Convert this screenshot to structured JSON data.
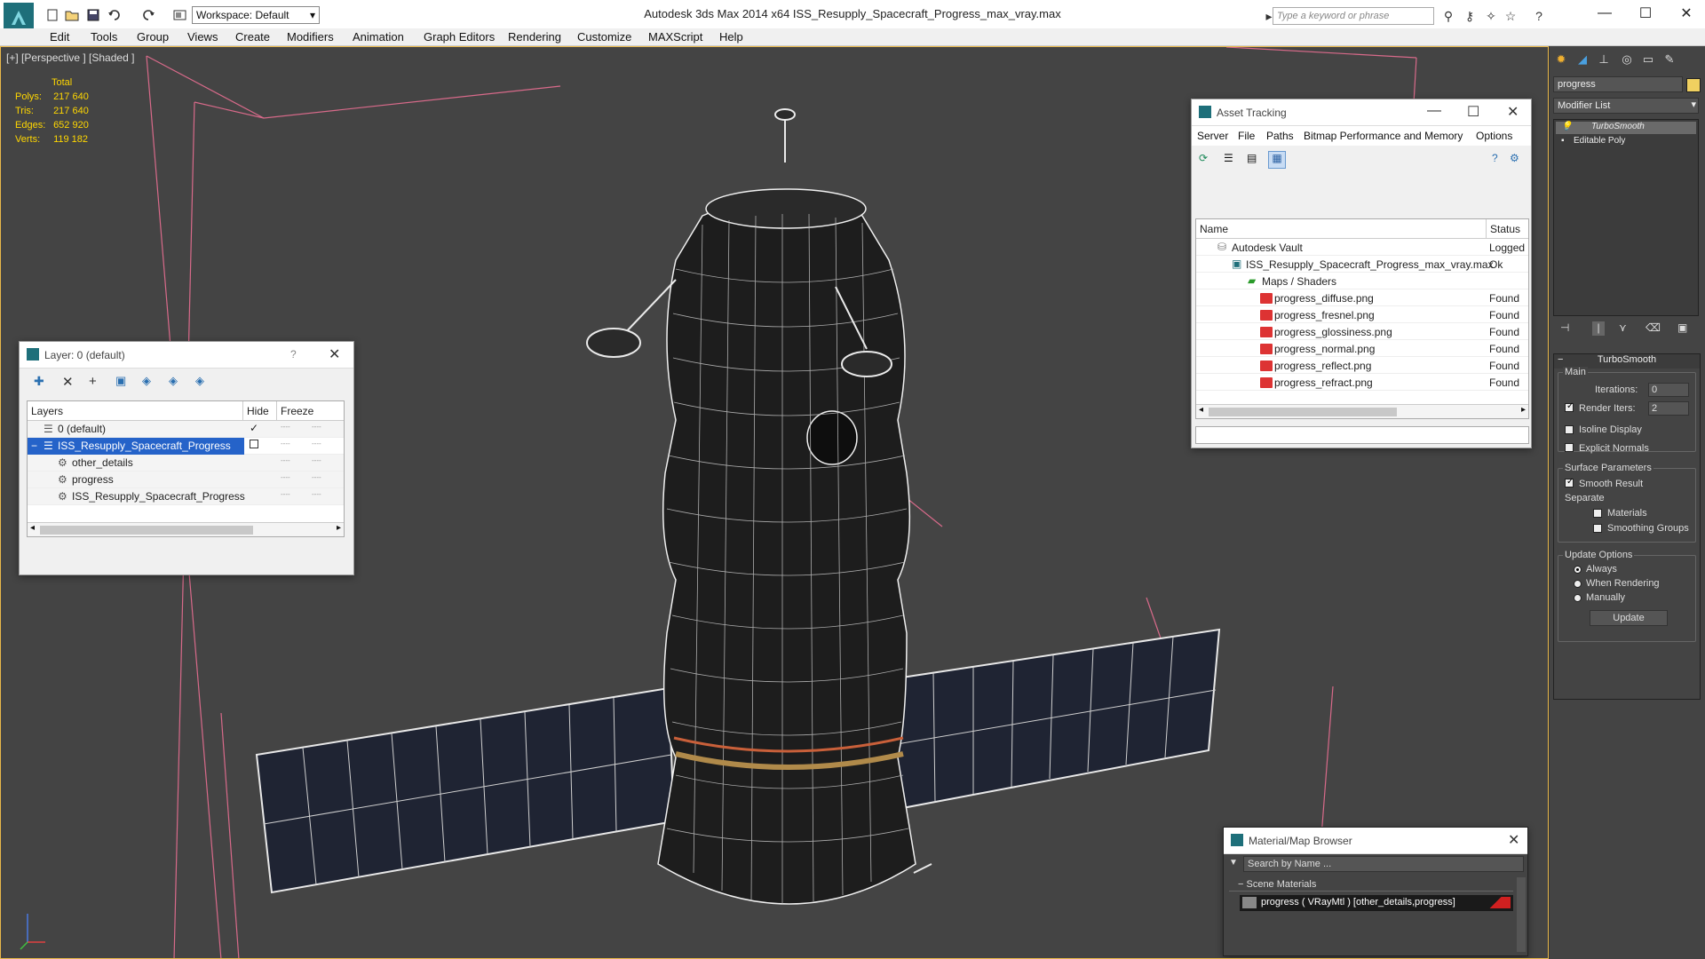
{
  "app": {
    "title": "Autodesk 3ds Max  2014 x64     ISS_Resupply_Spacecraft_Progress_max_vray.max",
    "workspace_label": "Workspace: Default",
    "search_placeholder": "Type a keyword or phrase"
  },
  "menu": [
    "Edit",
    "Tools",
    "Group",
    "Views",
    "Create",
    "Modifiers",
    "Animation",
    "Graph Editors",
    "Rendering",
    "Customize",
    "MAXScript",
    "Help"
  ],
  "viewport": {
    "label": "[+] [Perspective ] [Shaded ]",
    "stats": {
      "total_label": "Total",
      "rows": [
        {
          "k": "Polys:",
          "v": "217 640"
        },
        {
          "k": "Tris:",
          "v": "217 640"
        },
        {
          "k": "Edges:",
          "v": "652 920"
        },
        {
          "k": "Verts:",
          "v": "119 182"
        }
      ]
    }
  },
  "layer_dialog": {
    "title": "Layer: 0 (default)",
    "help": "?",
    "columns": {
      "layers": "Layers",
      "hide": "Hide",
      "freeze": "Freeze"
    },
    "rows": [
      {
        "name": "0 (default)",
        "dash1": "----",
        "dash2": "----"
      },
      {
        "name": "ISS_Resupply_Spacecraft_Progress",
        "dash1": "----",
        "dash2": "----"
      },
      {
        "name": "other_details",
        "dash1": "----",
        "dash2": "----"
      },
      {
        "name": "progress",
        "dash1": "----",
        "dash2": "----"
      },
      {
        "name": "ISS_Resupply_Spacecraft_Progress",
        "dash1": "----",
        "dash2": "----"
      }
    ]
  },
  "asset_tracking": {
    "title": "Asset Tracking",
    "menu": [
      "Server",
      "File",
      "Paths",
      "Bitmap Performance and Memory",
      "Options"
    ],
    "columns": {
      "name": "Name",
      "status": "Status"
    },
    "rows": [
      {
        "name": "Autodesk Vault",
        "status": "Logged C"
      },
      {
        "name": "ISS_Resupply_Spacecraft_Progress_max_vray.max",
        "status": "Ok"
      },
      {
        "name": "Maps / Shaders",
        "status": ""
      },
      {
        "name": "progress_diffuse.png",
        "status": "Found"
      },
      {
        "name": "progress_fresnel.png",
        "status": "Found"
      },
      {
        "name": "progress_glossiness.png",
        "status": "Found"
      },
      {
        "name": "progress_normal.png",
        "status": "Found"
      },
      {
        "name": "progress_reflect.png",
        "status": "Found"
      },
      {
        "name": "progress_refract.png",
        "status": "Found"
      }
    ]
  },
  "material_browser": {
    "title": "Material/Map Browser",
    "search_placeholder": "Search by Name ...",
    "section": "Scene Materials",
    "item": "progress  ( VRayMtl ) [other_details,progress]"
  },
  "command_panel": {
    "object_name": "progress",
    "modifier_list": "Modifier List",
    "stack": [
      "TurboSmooth",
      "Editable Poly"
    ],
    "rollout_title": "TurboSmooth",
    "main_label": "Main",
    "iterations_label": "Iterations:",
    "iterations_value": "0",
    "render_iters_label": "Render Iters:",
    "render_iters_value": "2",
    "isoline_label": "Isoline Display",
    "explicit_normals_label": "Explicit Normals",
    "surface_params_label": "Surface Parameters",
    "smooth_result_label": "Smooth Result",
    "separate_label": "Separate",
    "materials_label": "Materials",
    "smoothing_groups_label": "Smoothing Groups",
    "update_options_label": "Update Options",
    "always_label": "Always",
    "when_rendering_label": "When Rendering",
    "manually_label": "Manually",
    "update_button": "Update",
    "swatch_color": "#f0d060"
  }
}
